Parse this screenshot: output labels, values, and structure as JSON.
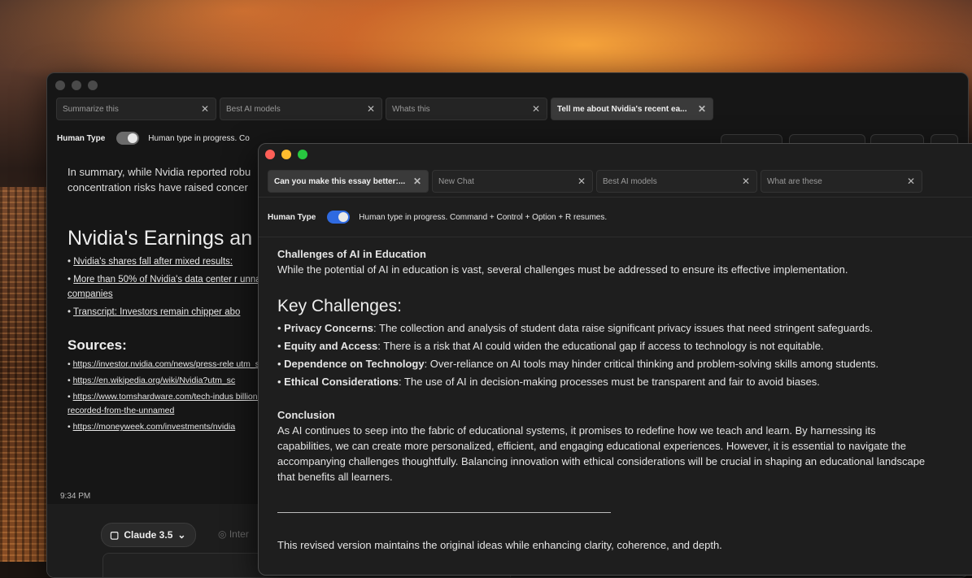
{
  "back_window": {
    "tabs": [
      {
        "label": "Summarize this",
        "active": false
      },
      {
        "label": "Best AI models",
        "active": false
      },
      {
        "label": "Whats this",
        "active": false
      },
      {
        "label": "Tell me about Nvidia's recent ea...",
        "active": true
      }
    ],
    "human_type_label": "Human Type",
    "human_type_status": "Human type in progress. Co",
    "summary_text": "In summary, while Nvidia reported robu concentration risks have raised concer",
    "heading": "Nvidia's Earnings an",
    "links": [
      "Nvidia's shares fall after mixed results:",
      "More than 50% of Nvidia's data center r unnamed companies",
      "Transcript: Investors remain chipper abo"
    ],
    "sources_heading": "Sources:",
    "sources": [
      "https://investor.nvidia.com/news/press-rele utm_source=openai",
      "https://en.wikipedia.org/wiki/Nvidia?utm_sc",
      "https://www.tomshardware.com/tech-indus billion-in-sales-recorded-from-the-unnamed",
      "https://moneyweek.com/investments/nvidia"
    ],
    "timestamp": "9:34 PM",
    "model_label": "Claude 3.5",
    "inter_label": "Inter"
  },
  "front_window": {
    "tabs": [
      {
        "label": "Can you make this essay better:...",
        "active": true
      },
      {
        "label": "New Chat",
        "active": false
      },
      {
        "label": "Best AI models",
        "active": false
      },
      {
        "label": "What are these",
        "active": false
      }
    ],
    "human_type_label": "Human Type",
    "human_type_status": "Human type in progress. Command + Control + Option + R resumes.",
    "toggle_on": true,
    "challenges_title": "Challenges of AI in Education",
    "challenges_intro": "While the potential of AI in education is vast, several challenges must be addressed to ensure its effective implementation.",
    "key_heading": "Key Challenges:",
    "key_items": [
      {
        "term": "Privacy Concerns",
        "text": ": The collection and analysis of student data raise significant privacy issues that need stringent safeguards."
      },
      {
        "term": "Equity and Access",
        "text": ": There is a risk that AI could widen the educational gap if access to technology is not equitable."
      },
      {
        "term": "Dependence on Technology",
        "text": ": Over-reliance on AI tools may hinder critical thinking and problem-solving skills among students."
      },
      {
        "term": "Ethical Considerations",
        "text": ": The use of AI in decision-making processes must be transparent and fair to avoid biases."
      }
    ],
    "conclusion_title": "Conclusion",
    "conclusion_text": "As AI continues to seep into the fabric of educational systems, it promises to redefine how we teach and learn. By harnessing its capabilities, we can create more personalized, efficient, and engaging educational experiences. However, it is essential to navigate the accompanying challenges thoughtfully. Balancing innovation with ethical considerations will be crucial in shaping an educational landscape that benefits all learners.",
    "closing_note": "This revised version maintains the original ideas while enhancing clarity, coherence, and depth."
  },
  "colors": {
    "toggle_on": "#2f6ae0",
    "close_dot": "#ff5f57",
    "min_dot": "#febc2e",
    "max_dot": "#28c840"
  }
}
